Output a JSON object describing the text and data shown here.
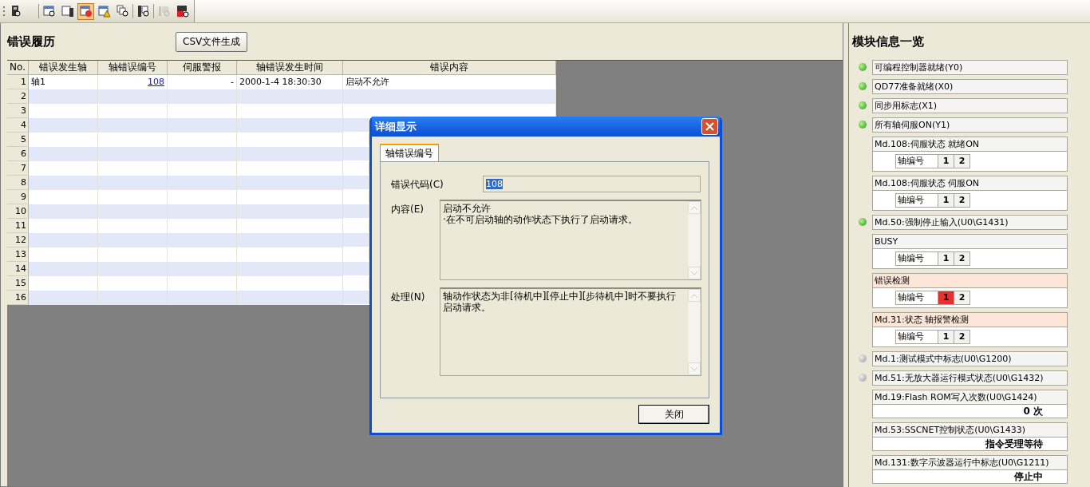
{
  "toolbar": [
    {
      "kind": "module",
      "selected": false,
      "disabled": false
    },
    {
      "kind": "list",
      "selected": false,
      "disabled": false
    },
    {
      "kind": "monitor",
      "selected": false,
      "disabled": false
    },
    {
      "kind": "error-table",
      "selected": true,
      "disabled": false
    },
    {
      "kind": "warning-table",
      "selected": false,
      "disabled": false
    },
    {
      "kind": "copy-search",
      "selected": false,
      "disabled": false
    },
    {
      "kind": "column-search",
      "selected": false,
      "disabled": false
    },
    {
      "kind": "grey-search",
      "selected": false,
      "disabled": true
    },
    {
      "kind": "red-search",
      "selected": false,
      "disabled": false
    }
  ],
  "history": {
    "title": "错误履历",
    "csv_button": "CSV文件生成",
    "table": {
      "columns": [
        "No.",
        "错误发生轴",
        "轴错误编号",
        "伺服警报",
        "轴错误发生时间",
        "错误内容"
      ],
      "rows": [
        {
          "no": "1",
          "axis": "轴1",
          "error_number": "108",
          "servo_alarm": "-",
          "time": "2000-1-4 18:30:30",
          "content": "启动不允许"
        },
        {
          "no": "2"
        },
        {
          "no": "3"
        },
        {
          "no": "4"
        },
        {
          "no": "5"
        },
        {
          "no": "6"
        },
        {
          "no": "7"
        },
        {
          "no": "8"
        },
        {
          "no": "9"
        },
        {
          "no": "10"
        },
        {
          "no": "11"
        },
        {
          "no": "12"
        },
        {
          "no": "13"
        },
        {
          "no": "14"
        },
        {
          "no": "15"
        },
        {
          "no": "16"
        }
      ]
    }
  },
  "dialog": {
    "title": "详细显示",
    "tab": {
      "label": "轴错误编号",
      "selected": true
    },
    "code_label": "错误代码(C)",
    "code_value": "108",
    "content_label": "内容(E)",
    "content_lines": [
      "启动不允许",
      "·在不可启动轴的动作状态下执行了启动请求。"
    ],
    "action_label": "处理(N)",
    "action_text": "轴动作状态为非[待机中][停止中][步待机中]时不要执行启动请求。",
    "close_button": "关闭"
  },
  "module_info": {
    "title": "模块信息一览",
    "items": [
      {
        "kind": "flag",
        "label": "可编程控制器就绪(Y0)",
        "on": true
      },
      {
        "kind": "flag",
        "label": "QD77准备就绪(X0)",
        "on": true
      },
      {
        "kind": "flag",
        "label": "同步用标志(X1)",
        "on": true
      },
      {
        "kind": "flag",
        "label": "所有轴伺服ON(Y1)",
        "on": true
      },
      {
        "kind": "axes",
        "label": "Md.108:伺服状态 就绪ON",
        "alert": false,
        "axis_label": "轴编号",
        "axes": [
          {
            "number": "1",
            "on": false
          },
          {
            "number": "2",
            "on": false
          }
        ]
      },
      {
        "kind": "axes",
        "label": "Md.108:伺服状态 伺服ON",
        "alert": false,
        "axis_label": "轴编号",
        "axes": [
          {
            "number": "1",
            "on": false
          },
          {
            "number": "2",
            "on": false
          }
        ]
      },
      {
        "kind": "flag",
        "label": "Md.50:强制停止输入(U0\\G1431)",
        "on": true
      },
      {
        "kind": "axes",
        "label": "BUSY",
        "alert": false,
        "axis_label": "轴编号",
        "axes": [
          {
            "number": "1",
            "on": false
          },
          {
            "number": "2",
            "on": false
          }
        ]
      },
      {
        "kind": "axes",
        "label": "错误检测",
        "alert": true,
        "axis_label": "轴编号",
        "axes": [
          {
            "number": "1",
            "on": true
          },
          {
            "number": "2",
            "on": false
          }
        ]
      },
      {
        "kind": "axes",
        "label": "Md.31:状态 轴报警检测",
        "alert": true,
        "axis_label": "轴编号",
        "axes": [
          {
            "number": "1",
            "on": false
          },
          {
            "number": "2",
            "on": false
          }
        ]
      },
      {
        "kind": "flag",
        "label": "Md.1:测试模式中标志(U0\\G1200)",
        "on": false
      },
      {
        "kind": "flag",
        "label": "Md.51:无放大器运行模式状态(U0\\G1432)",
        "on": false
      },
      {
        "kind": "value",
        "label": "Md.19:Flash ROM写入次数(U0\\G1424)",
        "value": "0 次"
      },
      {
        "kind": "value",
        "label": "Md.53:SSCNET控制状态(U0\\G1433)",
        "value": "指令受理等待"
      },
      {
        "kind": "value",
        "label": "Md.131:数字示波器运行中标志(U0\\G1211)",
        "value": "停止中"
      }
    ]
  }
}
